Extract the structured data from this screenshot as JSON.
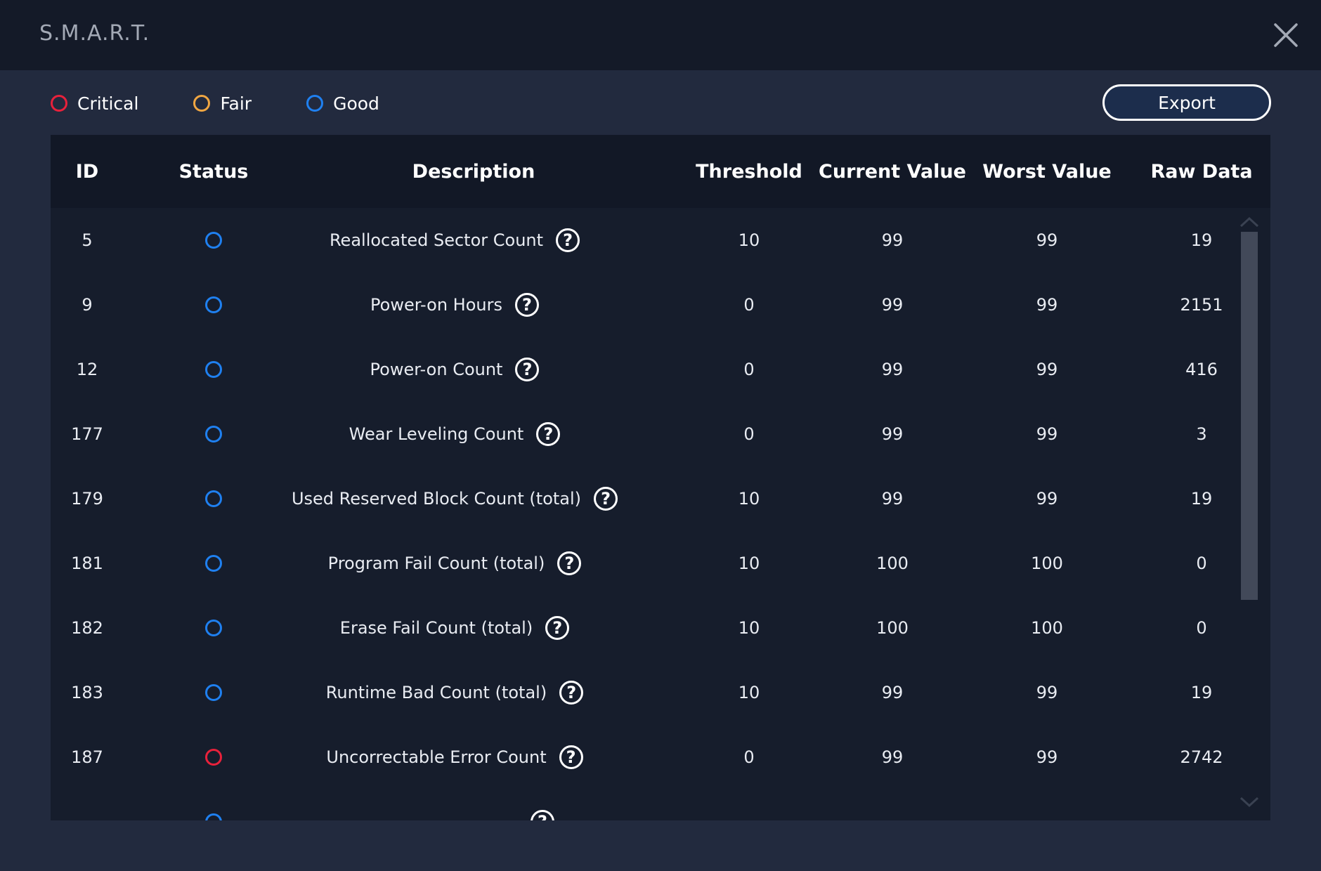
{
  "window": {
    "title": "S.M.A.R.T."
  },
  "legend": [
    {
      "label": "Critical",
      "color": "#e8213b"
    },
    {
      "label": "Fair",
      "color": "#f0a642"
    },
    {
      "label": "Good",
      "color": "#1f80f0"
    }
  ],
  "toolbar": {
    "export_label": "Export"
  },
  "table": {
    "headers": {
      "id": "ID",
      "status": "Status",
      "description": "Description",
      "threshold": "Threshold",
      "current": "Current Value",
      "worst": "Worst Value",
      "raw": "Raw Data"
    },
    "rows": [
      {
        "id": "5",
        "status": "good",
        "description": "Reallocated Sector Count",
        "threshold": "10",
        "current": "99",
        "worst": "99",
        "raw": "19"
      },
      {
        "id": "9",
        "status": "good",
        "description": "Power-on Hours",
        "threshold": "0",
        "current": "99",
        "worst": "99",
        "raw": "2151"
      },
      {
        "id": "12",
        "status": "good",
        "description": "Power-on Count",
        "threshold": "0",
        "current": "99",
        "worst": "99",
        "raw": "416"
      },
      {
        "id": "177",
        "status": "good",
        "description": "Wear Leveling Count",
        "threshold": "0",
        "current": "99",
        "worst": "99",
        "raw": "3"
      },
      {
        "id": "179",
        "status": "good",
        "description": "Used Reserved Block Count (total)",
        "threshold": "10",
        "current": "99",
        "worst": "99",
        "raw": "19"
      },
      {
        "id": "181",
        "status": "good",
        "description": "Program Fail Count (total)",
        "threshold": "10",
        "current": "100",
        "worst": "100",
        "raw": "0"
      },
      {
        "id": "182",
        "status": "good",
        "description": "Erase Fail Count (total)",
        "threshold": "10",
        "current": "100",
        "worst": "100",
        "raw": "0"
      },
      {
        "id": "183",
        "status": "good",
        "description": "Runtime Bad Count (total)",
        "threshold": "10",
        "current": "99",
        "worst": "99",
        "raw": "19"
      },
      {
        "id": "187",
        "status": "critical",
        "description": "Uncorrectable Error Count",
        "threshold": "0",
        "current": "99",
        "worst": "99",
        "raw": "2742"
      },
      {
        "id": "",
        "status": "good",
        "description": "",
        "threshold": "",
        "current": "",
        "worst": "",
        "raw": ""
      }
    ]
  },
  "icons": {
    "close": "close-icon",
    "help": "help-icon",
    "status": "status-ring-icon",
    "scroll_up": "chevron-up-icon",
    "scroll_down": "chevron-down-icon"
  },
  "colors": {
    "critical": "#e8213b",
    "fair": "#f0a642",
    "good": "#1f80f0"
  }
}
